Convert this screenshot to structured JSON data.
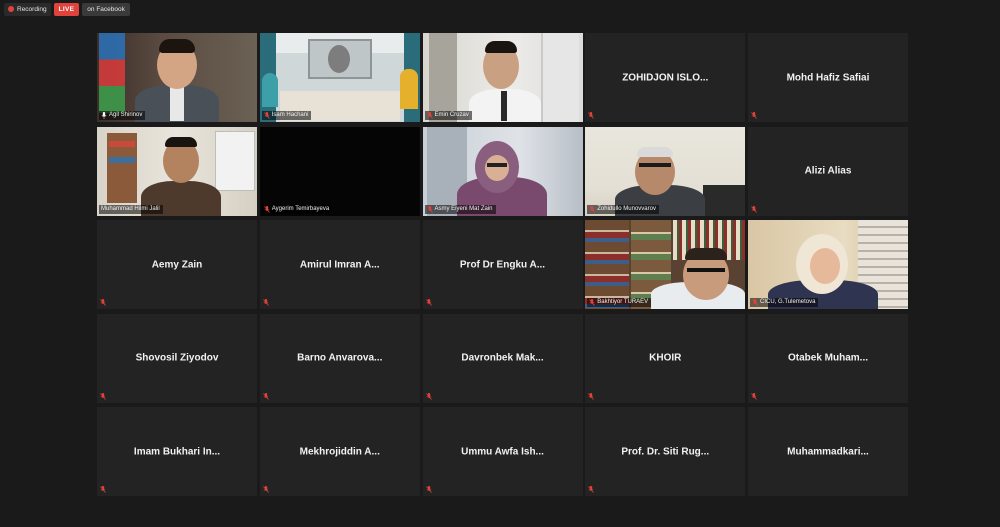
{
  "topbar": {
    "recording_label": "Recording",
    "live_label": "LIVE",
    "platform_label": "on Facebook"
  },
  "participants": [
    {
      "name": "Agil Shirinov",
      "video": true,
      "active": true
    },
    {
      "name": "Isam Hachani",
      "video": true
    },
    {
      "name": "Emin Cruzav",
      "video": true
    },
    {
      "name": "ZOHIDJON  ISLO...",
      "video": false
    },
    {
      "name": "Mohd Hafiz Safiai",
      "video": false
    },
    {
      "name": "Muhammad Hilmi Jalil",
      "video": true
    },
    {
      "name": "Aygerim Temirbayeva",
      "video": true,
      "black": true
    },
    {
      "name": "Asmy Eiyeni Mat Zain",
      "video": true
    },
    {
      "name": "Zohidullo Munovvarov",
      "video": true
    },
    {
      "name": "Alizi Alias",
      "video": false
    },
    {
      "name": "Aemy Zain",
      "video": false
    },
    {
      "name": "Amirul  Imran  A...",
      "video": false
    },
    {
      "name": "Prof Dr Engku A...",
      "video": false
    },
    {
      "name": "Bakhtiyor TURAEV",
      "video": true
    },
    {
      "name": "CICU, G.Tulemetova",
      "video": true
    },
    {
      "name": "Shovosil Ziyodov",
      "video": false
    },
    {
      "name": "Barno  Anvarova...",
      "video": false
    },
    {
      "name": "Davronbek  Mak...",
      "video": false
    },
    {
      "name": "KHOIR",
      "video": false
    },
    {
      "name": "Otabek  Muham...",
      "video": false
    },
    {
      "name": "Imam  Bukhari  In...",
      "video": false
    },
    {
      "name": "Mekhrojiddin  A...",
      "video": false
    },
    {
      "name": "Ummu  Awfa  Ish...",
      "video": false
    },
    {
      "name": "Prof.  Dr.  Siti  Rug...",
      "video": false
    },
    {
      "name": "Muhammadkari...",
      "video": false
    }
  ],
  "colors": {
    "background": "#1a1a1a",
    "tile": "#232323",
    "active_border": "#cfd64b",
    "live_red": "#e0433b",
    "muted_red": "#e0433b"
  },
  "icons": {
    "recording": "recording-dot-icon",
    "muted": "mic-muted-icon",
    "speaking": "mic-active-icon"
  }
}
